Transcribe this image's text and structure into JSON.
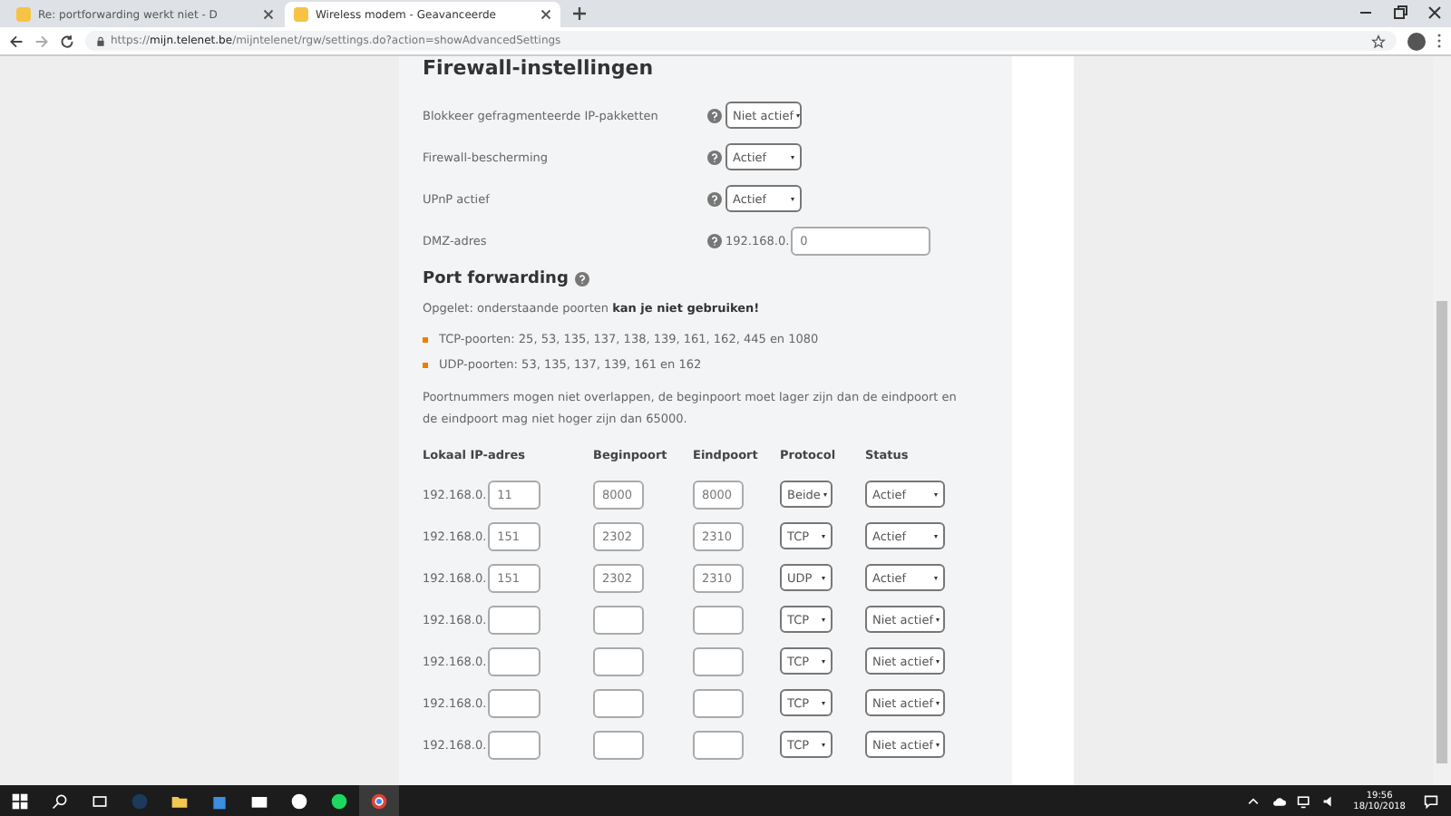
{
  "browser": {
    "tabs": [
      {
        "title": "Re: portforwarding werkt niet - D",
        "selected": false
      },
      {
        "title": "Wireless modem - Geavanceerde",
        "selected": true
      }
    ],
    "url": "https://**mijn.telenet.be**/mijntelenet/rgw/settings.do?action=showAdvancedSettings"
  },
  "firewall": {
    "title": "Firewall-instellingen",
    "settings": [
      {
        "label": "Blokkeer gefragmenteerde IP-pakketten",
        "kind": "select",
        "value": "Niet actief"
      },
      {
        "label": "Firewall-bescherming",
        "kind": "select",
        "value": "Actief"
      },
      {
        "label": "UPnP actief",
        "kind": "select",
        "value": "Actief"
      },
      {
        "label": "DMZ-adres",
        "kind": "input",
        "prefix": "192.168.0.",
        "value": "0"
      }
    ]
  },
  "port_forwarding": {
    "title": "Port forwarding",
    "warning": "Opgelet: onderstaande poorten **kan je niet gebruiken!**",
    "blocked": [
      "TCP-poorten: 25, 53, 135, 137, 138, 139, 161, 162, 445 en 1080",
      "UDP-poorten: 53, 135, 137, 139, 161 en 162"
    ],
    "note": "Poortnummers mogen niet overlappen, de beginpoort moet lager zijn dan de eindpoort en de eindpoort mag niet hoger zijn dan 65000.",
    "columns": [
      "Lokaal IP-adres",
      "Beginpoort",
      "Eindpoort",
      "Protocol",
      "Status"
    ],
    "rows": [
      {
        "prefix": "192.168.0.",
        "ip": "11",
        "begin": "8000",
        "end": "8000",
        "protocol": "Beide",
        "status": "Actief"
      },
      {
        "prefix": "192.168.0.",
        "ip": "151",
        "begin": "2302",
        "end": "2310",
        "protocol": "TCP",
        "status": "Actief"
      },
      {
        "prefix": "192.168.0.",
        "ip": "151",
        "begin": "2302",
        "end": "2310",
        "protocol": "UDP",
        "status": "Actief"
      },
      {
        "prefix": "192.168.0.",
        "ip": "",
        "begin": "",
        "end": "",
        "protocol": "TCP",
        "status": "Niet actief"
      },
      {
        "prefix": "192.168.0.",
        "ip": "",
        "begin": "",
        "end": "",
        "protocol": "TCP",
        "status": "Niet actief"
      },
      {
        "prefix": "192.168.0.",
        "ip": "",
        "begin": "",
        "end": "",
        "protocol": "TCP",
        "status": "Niet actief"
      },
      {
        "prefix": "192.168.0.",
        "ip": "",
        "begin": "",
        "end": "",
        "protocol": "TCP",
        "status": "Niet actief"
      }
    ]
  },
  "taskbar": {
    "time": "19:56",
    "date": "18/10/2018"
  }
}
